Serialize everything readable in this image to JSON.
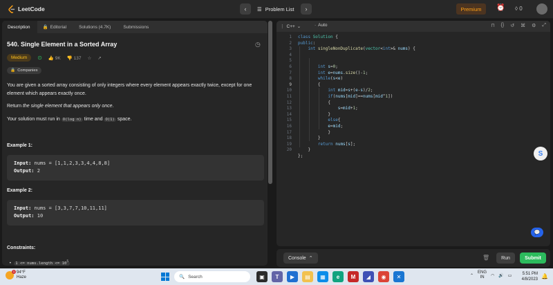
{
  "nav": {
    "logo_text": "LeetCode",
    "problem_list": "Problem List",
    "premium": "Premium",
    "streak": "0"
  },
  "tabs": [
    {
      "label": "Description"
    },
    {
      "label": "Editorial"
    },
    {
      "label": "Solutions (4.7K)"
    },
    {
      "label": "Submissions"
    }
  ],
  "problem": {
    "title": "540. Single Element in a Sorted Array",
    "difficulty": "Medium",
    "likes": "9K",
    "dislikes": "137",
    "companies": "Companies",
    "desc1": "You are given a sorted array consisting of only integers where every element appears exactly twice, except for one element which appears exactly once.",
    "desc2_prefix": "Return ",
    "desc2_em": "the single element that appears only once",
    "desc2_suffix": ".",
    "desc3_prefix": "Your solution must run in ",
    "desc3_code1": "O(log n)",
    "desc3_mid": " time and ",
    "desc3_code2": "O(1)",
    "desc3_suffix": " space.",
    "ex1_heading": "Example 1:",
    "ex1_input_label": "Input:",
    "ex1_input": " nums = [1,1,2,3,3,4,4,8,8]",
    "ex1_output_label": "Output:",
    "ex1_output": " 2",
    "ex2_heading": "Example 2:",
    "ex2_input_label": "Input:",
    "ex2_input": " nums = [3,3,7,7,10,11,11]",
    "ex2_output_label": "Output:",
    "ex2_output": " 10",
    "constraints_heading": "Constraints:",
    "constraint1": "1 <= nums.length <= 10",
    "constraint1_sup": "5"
  },
  "editor": {
    "language": "C++",
    "autocomplete": "Auto",
    "lines": [
      "1",
      "2",
      "3",
      "4",
      "5",
      "6",
      "7",
      "8",
      "9",
      "10",
      "11",
      "12",
      "13",
      "14",
      "15",
      "16",
      "17",
      "18",
      "19",
      "20"
    ]
  },
  "console": {
    "console_label": "Console",
    "run_label": "Run",
    "submit_label": "Submit"
  },
  "taskbar": {
    "temp": "94°F",
    "weather": "Haze",
    "search": "Search",
    "lang_top": "ENG",
    "lang_bottom": "IN",
    "time": "5:51 PM",
    "date": "4/8/2023"
  },
  "colors": {
    "accent_green": "#2cbb5d",
    "premium_orange": "#ffa116",
    "medium_yellow": "#ffc01e"
  }
}
